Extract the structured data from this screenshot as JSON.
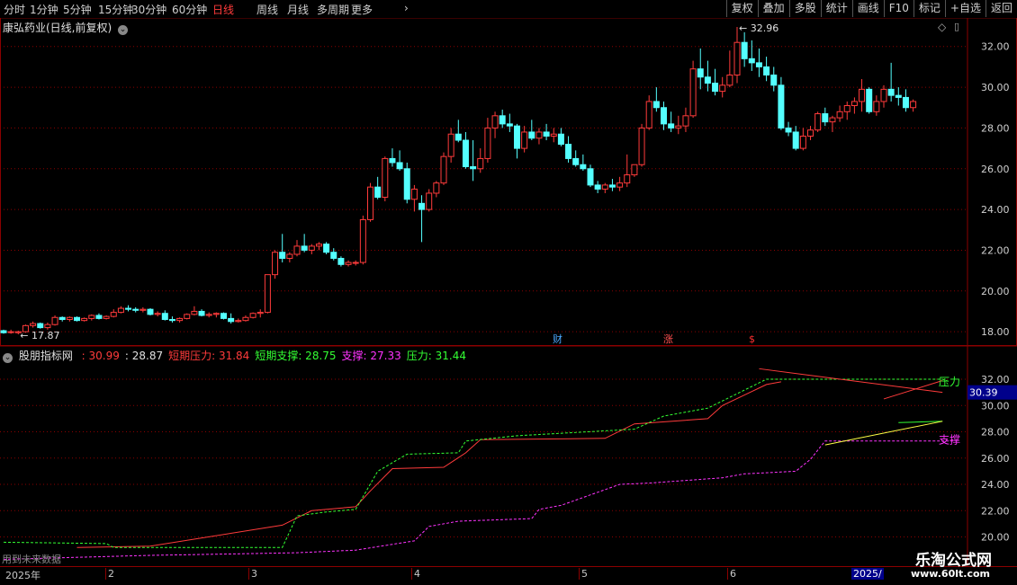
{
  "toolbar": {
    "periods": [
      "分时",
      "1分钟",
      "5分钟",
      "15分钟",
      "30分钟",
      "60分钟",
      "日线",
      "周线",
      "月线",
      "多周期",
      "更多"
    ],
    "active": "日线",
    "right_buttons": [
      "复权",
      "叠加",
      "多股",
      "统计",
      "画线",
      "F10",
      "标记",
      "+自选",
      "返回"
    ]
  },
  "main_chart": {
    "title": "康弘药业(日线,前复权)",
    "y_ticks": [
      "32.00",
      "30.00",
      "28.00",
      "26.00",
      "24.00",
      "22.00",
      "20.00",
      "18.00"
    ],
    "high_label": "32.96",
    "low_label": "17.87",
    "markers": [
      {
        "text": "财",
        "color": "#4aa8ff"
      },
      {
        "text": "涨",
        "color": "#ff5050"
      },
      {
        "text": "$",
        "color": "#ff3030"
      }
    ]
  },
  "indicator": {
    "name": "股朋指标网",
    "values": [
      {
        "label": "",
        "value": "30.99",
        "color": "#ff3b3b"
      },
      {
        "label": "",
        "value": "28.87",
        "color": "#e0e0e0"
      },
      {
        "label": "短期压力",
        "value": "31.84",
        "color": "#ff3b3b"
      },
      {
        "label": "短期支撑",
        "value": "28.75",
        "color": "#33ff33"
      },
      {
        "label": "支撑",
        "value": "27.33",
        "color": "#ff33ff"
      },
      {
        "label": "压力",
        "value": "31.44",
        "color": "#33ff33"
      }
    ],
    "y_ticks": [
      "32.00",
      "30.00",
      "28.00",
      "26.00",
      "24.00",
      "22.00",
      "20.00"
    ],
    "current_value": "30.39",
    "label_pressure": "压力",
    "label_support": "支撑",
    "footnote": "用到未来数据"
  },
  "date_axis": {
    "labels": [
      "2025年",
      "2",
      "3",
      "4",
      "5",
      "6"
    ],
    "right_label": "2025/"
  },
  "watermark": {
    "line1": "乐淘公式网",
    "line2": "www.60lt.com"
  },
  "colors": {
    "up": "#ff3b3b",
    "down": "#54ffff",
    "grid": "#8b0000",
    "pressure": "#ff3b3b",
    "support_short": "#33ff33",
    "support": "#ff33ff"
  },
  "chart_data": [
    {
      "type": "candlestick",
      "title": "康弘药业(日线,前复权)",
      "x_labels": [
        "2025年",
        "2",
        "3",
        "4",
        "5",
        "6"
      ],
      "ylim": [
        17.3,
        33.4
      ],
      "ohlc": [
        [
          18.05,
          18.1,
          17.9,
          17.95
        ],
        [
          18.0,
          18.1,
          17.9,
          18.0
        ],
        [
          17.95,
          18.05,
          17.87,
          18.0
        ],
        [
          18.0,
          18.35,
          17.95,
          18.3
        ],
        [
          18.3,
          18.5,
          18.2,
          18.4
        ],
        [
          18.4,
          18.45,
          18.15,
          18.2
        ],
        [
          18.2,
          18.45,
          18.1,
          18.35
        ],
        [
          18.35,
          18.8,
          18.3,
          18.7
        ],
        [
          18.7,
          18.75,
          18.5,
          18.6
        ],
        [
          18.6,
          18.75,
          18.5,
          18.7
        ],
        [
          18.7,
          18.75,
          18.5,
          18.55
        ],
        [
          18.55,
          18.7,
          18.5,
          18.65
        ],
        [
          18.65,
          18.85,
          18.55,
          18.8
        ],
        [
          18.8,
          18.9,
          18.6,
          18.65
        ],
        [
          18.65,
          18.8,
          18.6,
          18.75
        ],
        [
          18.75,
          19.1,
          18.7,
          18.95
        ],
        [
          18.95,
          19.25,
          18.9,
          19.15
        ],
        [
          19.15,
          19.3,
          19.0,
          19.1
        ],
        [
          19.1,
          19.2,
          18.95,
          19.05
        ],
        [
          19.05,
          19.2,
          18.95,
          19.1
        ],
        [
          19.1,
          19.15,
          18.8,
          18.85
        ],
        [
          18.85,
          19.0,
          18.75,
          18.9
        ],
        [
          18.9,
          19.05,
          18.55,
          18.6
        ],
        [
          18.6,
          18.75,
          18.45,
          18.55
        ],
        [
          18.55,
          18.7,
          18.45,
          18.65
        ],
        [
          18.65,
          18.9,
          18.6,
          18.85
        ],
        [
          18.85,
          19.25,
          18.8,
          19.0
        ],
        [
          19.0,
          19.1,
          18.75,
          18.8
        ],
        [
          18.8,
          18.95,
          18.7,
          18.85
        ],
        [
          18.85,
          18.95,
          18.7,
          18.9
        ],
        [
          18.9,
          18.95,
          18.6,
          18.65
        ],
        [
          18.65,
          18.9,
          18.4,
          18.5
        ],
        [
          18.5,
          18.65,
          18.45,
          18.55
        ],
        [
          18.55,
          18.8,
          18.5,
          18.7
        ],
        [
          18.7,
          18.95,
          18.65,
          18.9
        ],
        [
          18.9,
          19.1,
          18.7,
          18.95
        ],
        [
          18.95,
          20.8,
          18.9,
          20.8
        ],
        [
          20.8,
          22.0,
          20.6,
          21.9
        ],
        [
          21.9,
          22.8,
          21.4,
          21.6
        ],
        [
          21.6,
          21.9,
          21.4,
          21.8
        ],
        [
          21.8,
          22.5,
          21.7,
          22.2
        ],
        [
          22.2,
          22.8,
          21.9,
          22.0
        ],
        [
          22.0,
          22.3,
          21.8,
          22.2
        ],
        [
          22.2,
          22.4,
          22.0,
          22.3
        ],
        [
          22.3,
          22.4,
          21.8,
          21.9
        ],
        [
          21.9,
          22.1,
          21.5,
          21.6
        ],
        [
          21.6,
          21.7,
          21.2,
          21.3
        ],
        [
          21.3,
          21.5,
          21.2,
          21.4
        ],
        [
          21.4,
          21.5,
          21.25,
          21.4
        ],
        [
          21.4,
          23.7,
          21.3,
          23.5
        ],
        [
          23.5,
          25.3,
          23.4,
          25.1
        ],
        [
          25.1,
          25.6,
          24.5,
          24.6
        ],
        [
          24.6,
          26.6,
          24.4,
          26.5
        ],
        [
          26.5,
          27.0,
          26.1,
          26.3
        ],
        [
          26.3,
          26.9,
          25.9,
          26.0
        ],
        [
          26.0,
          26.3,
          24.3,
          24.5
        ],
        [
          24.5,
          25.2,
          23.9,
          25.0
        ],
        [
          24.3,
          24.7,
          22.4,
          24.0
        ],
        [
          24.0,
          25.0,
          23.9,
          24.8
        ],
        [
          24.8,
          25.4,
          24.6,
          25.3
        ],
        [
          25.3,
          26.8,
          25.2,
          26.6
        ],
        [
          26.6,
          28.0,
          26.3,
          27.7
        ],
        [
          27.7,
          28.4,
          27.3,
          27.4
        ],
        [
          27.4,
          27.8,
          26.0,
          26.1
        ],
        [
          26.1,
          27.4,
          25.4,
          26.0
        ],
        [
          26.0,
          27.0,
          25.8,
          26.5
        ],
        [
          26.5,
          28.5,
          26.3,
          28.0
        ],
        [
          28.0,
          28.8,
          27.5,
          28.6
        ],
        [
          28.6,
          28.9,
          28.0,
          28.2
        ],
        [
          28.2,
          28.7,
          27.8,
          28.1
        ],
        [
          28.1,
          28.2,
          26.5,
          27.0
        ],
        [
          27.0,
          28.1,
          26.8,
          27.8
        ],
        [
          27.8,
          28.4,
          27.4,
          27.5
        ],
        [
          27.5,
          28.0,
          27.2,
          27.8
        ],
        [
          27.8,
          28.2,
          27.4,
          27.6
        ],
        [
          27.6,
          28.0,
          27.3,
          27.7
        ],
        [
          27.7,
          28.0,
          27.1,
          27.2
        ],
        [
          27.2,
          27.6,
          26.3,
          26.5
        ],
        [
          26.5,
          26.9,
          26.1,
          26.2
        ],
        [
          26.2,
          26.7,
          25.9,
          26.0
        ],
        [
          26.0,
          26.2,
          25.1,
          25.2
        ],
        [
          25.2,
          25.4,
          24.8,
          25.0
        ],
        [
          25.0,
          25.3,
          24.8,
          25.2
        ],
        [
          25.2,
          25.5,
          24.9,
          25.1
        ],
        [
          25.1,
          25.6,
          24.9,
          25.3
        ],
        [
          25.3,
          26.7,
          25.1,
          25.7
        ],
        [
          25.7,
          26.2,
          25.6,
          26.2
        ],
        [
          26.2,
          28.2,
          26.1,
          28.0
        ],
        [
          28.0,
          29.6,
          27.9,
          29.3
        ],
        [
          29.3,
          30.0,
          28.8,
          29.0
        ],
        [
          29.0,
          29.3,
          27.9,
          28.2
        ],
        [
          28.2,
          28.8,
          27.8,
          28.0
        ],
        [
          28.0,
          28.6,
          27.7,
          28.1
        ],
        [
          28.1,
          29.0,
          27.8,
          28.6
        ],
        [
          28.6,
          31.3,
          28.5,
          30.9
        ],
        [
          30.9,
          31.9,
          29.9,
          30.5
        ],
        [
          30.5,
          31.3,
          29.8,
          30.2
        ],
        [
          30.2,
          30.9,
          29.6,
          29.8
        ],
        [
          29.8,
          30.5,
          29.5,
          30.1
        ],
        [
          30.1,
          31.8,
          30.0,
          30.6
        ],
        [
          30.6,
          32.96,
          30.2,
          32.2
        ],
        [
          32.2,
          32.7,
          31.0,
          31.4
        ],
        [
          31.4,
          32.3,
          30.8,
          31.2
        ],
        [
          31.2,
          31.9,
          30.5,
          31.0
        ],
        [
          31.0,
          31.5,
          30.3,
          30.6
        ],
        [
          30.6,
          31.0,
          29.8,
          30.1
        ],
        [
          30.1,
          30.5,
          27.9,
          28.0
        ],
        [
          28.0,
          28.3,
          27.6,
          27.8
        ],
        [
          27.8,
          28.1,
          26.9,
          27.0
        ],
        [
          27.0,
          28.0,
          26.9,
          27.6
        ],
        [
          27.6,
          28.1,
          27.4,
          27.9
        ],
        [
          27.9,
          28.8,
          27.8,
          28.7
        ],
        [
          28.7,
          29.0,
          28.1,
          28.3
        ],
        [
          28.3,
          28.6,
          27.8,
          28.5
        ],
        [
          28.5,
          29.1,
          28.3,
          28.8
        ],
        [
          28.8,
          29.3,
          28.4,
          29.1
        ],
        [
          29.1,
          29.5,
          28.7,
          29.3
        ],
        [
          29.3,
          30.4,
          28.8,
          29.9
        ],
        [
          29.9,
          30.0,
          28.7,
          28.8
        ],
        [
          28.8,
          29.6,
          28.6,
          29.3
        ],
        [
          29.3,
          30.1,
          29.0,
          29.9
        ],
        [
          29.9,
          31.2,
          29.3,
          29.6
        ],
        [
          29.6,
          30.0,
          29.1,
          29.5
        ],
        [
          29.5,
          29.9,
          28.8,
          29.0
        ],
        [
          29.0,
          29.4,
          28.8,
          29.3
        ]
      ]
    },
    {
      "type": "line",
      "title": "股朋指标网",
      "ylim": [
        19.9,
        33.3
      ],
      "series": [
        {
          "name": "短期压力",
          "color": "#ff3b3b",
          "style": "solid",
          "points": [
            [
              10,
              19.2
            ],
            [
              20,
              19.3
            ],
            [
              38,
              20.9
            ],
            [
              42,
              22.0
            ],
            [
              48,
              22.3
            ],
            [
              50,
              23.5
            ],
            [
              53,
              25.2
            ],
            [
              60,
              25.3
            ],
            [
              63,
              26.4
            ],
            [
              65,
              27.4
            ],
            [
              82,
              27.5
            ],
            [
              86,
              28.6
            ],
            [
              96,
              29.0
            ],
            [
              98,
              30.0
            ],
            [
              101,
              30.8
            ],
            [
              104,
              31.6
            ],
            [
              106,
              31.8
            ]
          ]
        },
        {
          "name": "短期支撑",
          "color": "#33ff33",
          "style": "dashed",
          "points": [
            [
              0,
              19.6
            ],
            [
              14,
              19.5
            ],
            [
              15,
              19.2
            ],
            [
              38,
              19.2
            ],
            [
              40,
              21.6
            ],
            [
              44,
              21.9
            ],
            [
              48,
              22.1
            ],
            [
              51,
              25.0
            ],
            [
              55,
              26.3
            ],
            [
              62,
              26.4
            ],
            [
              63,
              27.3
            ],
            [
              70,
              27.7
            ],
            [
              86,
              28.2
            ],
            [
              90,
              29.2
            ],
            [
              96,
              29.8
            ],
            [
              100,
              30.9
            ],
            [
              104,
              32.0
            ],
            [
              128,
              32.0
            ],
            [
              129,
              31.8
            ]
          ]
        },
        {
          "name": "支撑",
          "color": "#ff33ff",
          "style": "dashed",
          "points": [
            [
              0,
              18.3
            ],
            [
              20,
              18.6
            ],
            [
              30,
              18.7
            ],
            [
              40,
              18.8
            ],
            [
              48,
              19.0
            ],
            [
              56,
              19.7
            ],
            [
              58,
              20.8
            ],
            [
              62,
              21.2
            ],
            [
              72,
              21.4
            ],
            [
              73,
              22.1
            ],
            [
              76,
              22.4
            ],
            [
              80,
              23.2
            ],
            [
              84,
              24.0
            ],
            [
              88,
              24.1
            ],
            [
              98,
              24.5
            ],
            [
              101,
              24.8
            ],
            [
              108,
              25.0
            ],
            [
              110,
              25.9
            ],
            [
              112,
              27.3
            ],
            [
              130,
              27.3
            ]
          ]
        },
        {
          "name": "压力",
          "color": "#33ff33",
          "style": "solid",
          "points": [
            [
              122,
              28.7
            ],
            [
              128,
              28.8
            ]
          ]
        }
      ]
    }
  ]
}
